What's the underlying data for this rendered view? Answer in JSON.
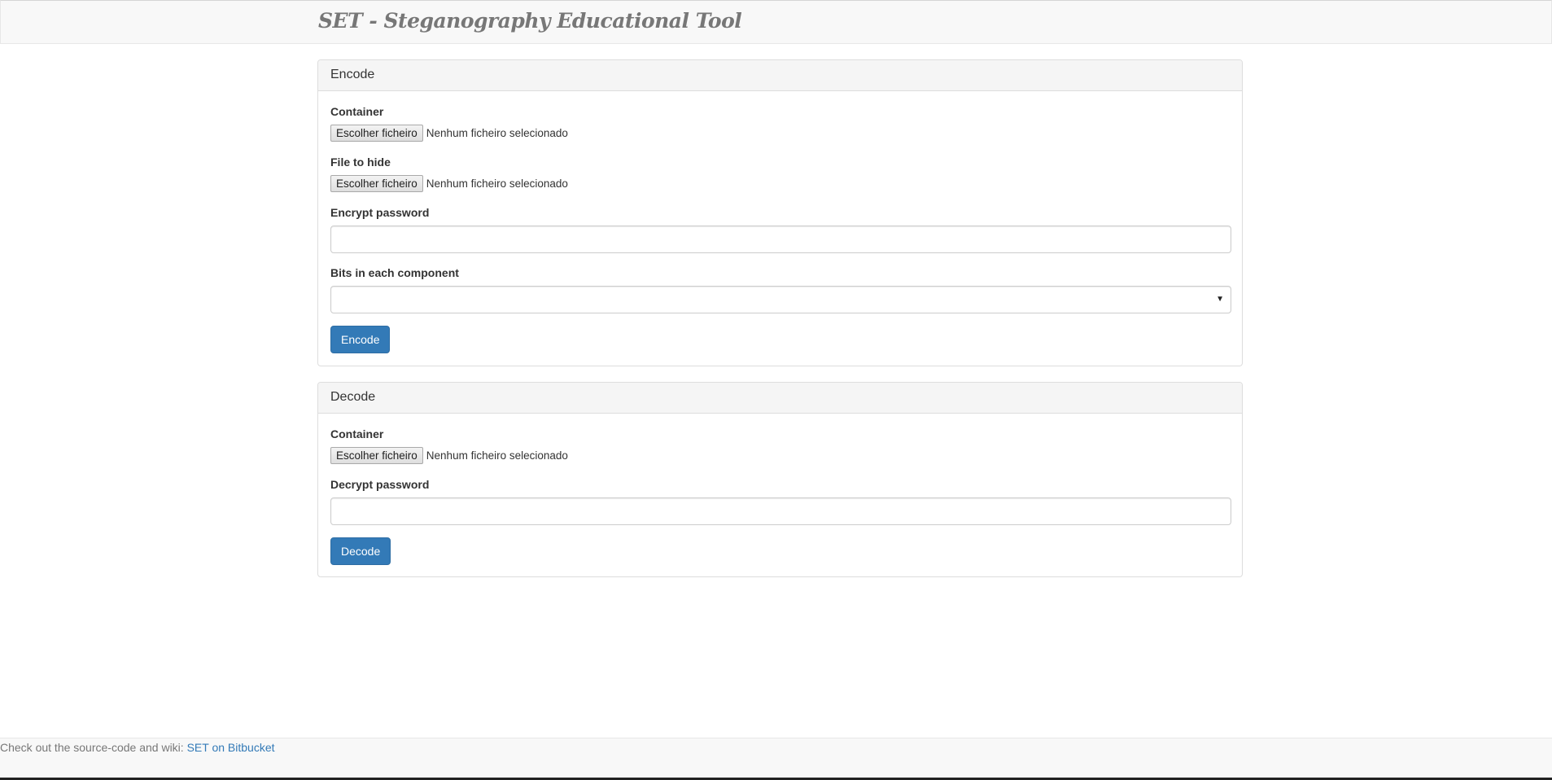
{
  "app": {
    "title": "SET - Steganography Educational Tool"
  },
  "encode": {
    "heading": "Encode",
    "container_label": "Container",
    "container_button": "Escolher ficheiro",
    "container_status": "Nenhum ficheiro selecionado",
    "file_label": "File to hide",
    "file_button": "Escolher ficheiro",
    "file_status": "Nenhum ficheiro selecionado",
    "password_label": "Encrypt password",
    "password_value": "",
    "bits_label": "Bits in each component",
    "bits_value": "",
    "bits_caret": "▼",
    "submit_label": "Encode"
  },
  "decode": {
    "heading": "Decode",
    "container_label": "Container",
    "container_button": "Escolher ficheiro",
    "container_status": "Nenhum ficheiro selecionado",
    "password_label": "Decrypt password",
    "password_value": "",
    "submit_label": "Decode"
  },
  "footer": {
    "text": "Check out the source-code and wiki: ",
    "link_text": "SET on Bitbucket"
  },
  "colors": {
    "primary": "#337ab7",
    "navbar_bg": "#f8f8f8",
    "panel_heading_bg": "#f5f5f5",
    "border": "#dddddd"
  }
}
